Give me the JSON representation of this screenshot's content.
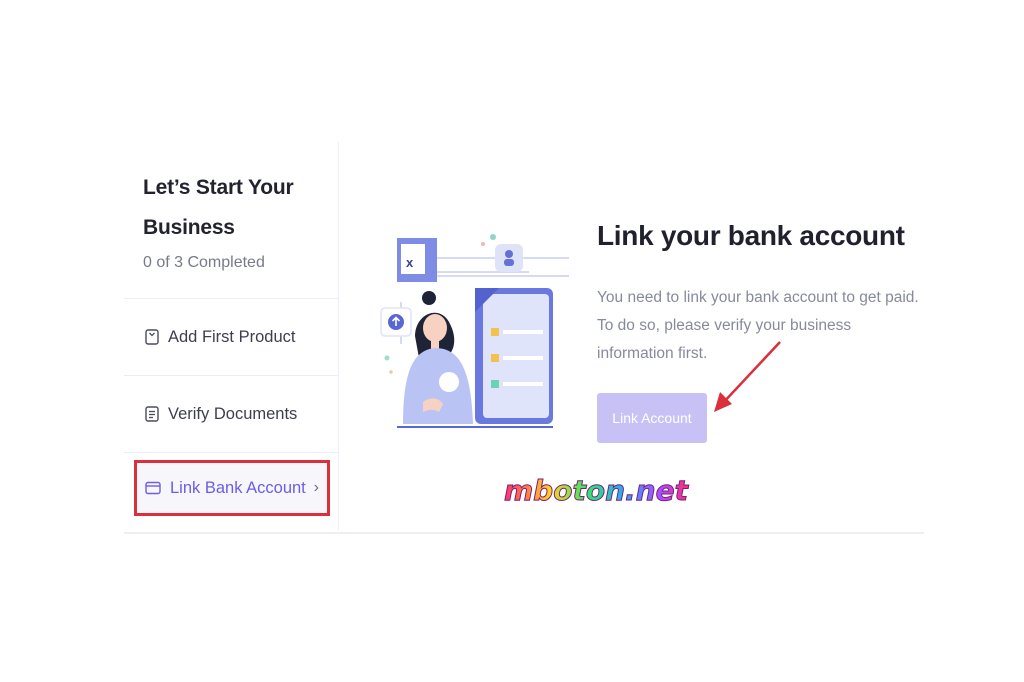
{
  "sidebar": {
    "title": "Let’s Start Your Business",
    "progress": "0 of 3 Completed",
    "steps": [
      {
        "label": "Add First Product",
        "icon": "product-icon"
      },
      {
        "label": "Verify Documents",
        "icon": "document-icon"
      },
      {
        "label": "Link Bank Account",
        "icon": "bank-card-icon",
        "active": true
      }
    ]
  },
  "main": {
    "title": "Link your bank account",
    "description": "You need to link your bank account to get paid. To do so, please verify your business information first.",
    "button_label": "Link Account"
  },
  "watermark": {
    "text": "mboton.net"
  },
  "colors": {
    "accent": "#6c5ce7",
    "button_bg": "#c8c1f5",
    "highlight_border": "#dc2f3c",
    "annotation_arrow": "#dc2f3c"
  }
}
